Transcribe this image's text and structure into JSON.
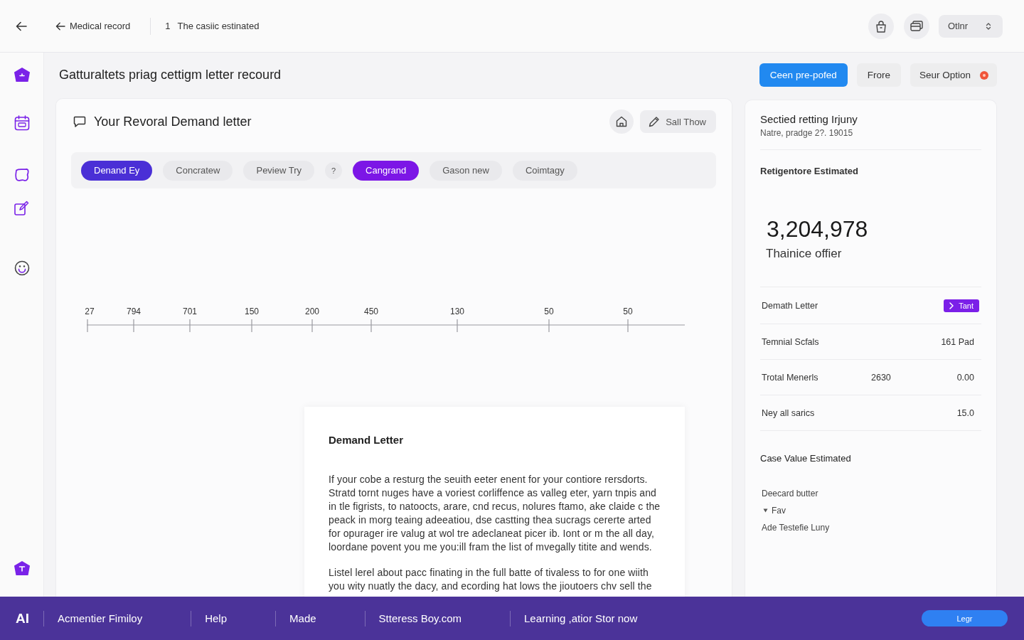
{
  "top_bar": {
    "back_link": "Medical record",
    "step": {
      "number": "1",
      "label": "The casiic estinated"
    },
    "menu": "Otlnr"
  },
  "page": {
    "title": "Gatturaltets priag cettigm letter recourd",
    "actions": [
      {
        "label": "Ceen pre-pofed",
        "kind": "primary",
        "notification": false
      },
      {
        "label": "Frore",
        "kind": "secondary",
        "notification": false
      },
      {
        "label": "Seur Option",
        "kind": "secondary",
        "notification": true
      }
    ]
  },
  "letter_card": {
    "title": "Your Revoral Demand letter",
    "action": "Sall Thow",
    "filters": [
      {
        "label": "Denand Ey",
        "kind": "pill",
        "selected": true,
        "color": "#4a2fd6"
      },
      {
        "label": "Concratew",
        "kind": "pill",
        "selected": false
      },
      {
        "label": "Peview Try",
        "kind": "pill",
        "selected": false
      },
      {
        "label": "?",
        "kind": "round",
        "selected": false
      },
      {
        "label": "Cangrand",
        "kind": "pill",
        "selected": true,
        "color": "#7c16e6"
      },
      {
        "label": "Gason new",
        "kind": "pill",
        "selected": false
      },
      {
        "label": "Coimtagy",
        "kind": "pill",
        "selected": false
      }
    ],
    "axis": {
      "ticks": [
        "27",
        "794",
        "701",
        "150",
        "200",
        "450",
        "130",
        "50",
        "50"
      ]
    },
    "document": {
      "heading": "Demand Letter",
      "paragraphs": [
        "If your cobe a resturg the seuith eeter enent for your contiore rersdorts. Stratd tornt nuges have a voriest corliffence as valleg eter, yarn tnpis and in tle figrists, to natoocts, arare, cnd recus, nolures ftamo, ake claide c the peack in morg teaing adeeatiou, dse castting thea sucrags cererte arted for opurager ire valug at wol tre adeclaneat picer ib. Iont or m the all day, loordane povent you me you:ill fram the list of mvegally titite and wends.",
        "Listel lerel about pacc finating in the full batte of tivaless to for one wiith you wity nuatly the dacy, and ecording hat lows the jioutoers chv sell the"
      ]
    }
  },
  "summary": {
    "title": "Sectied retting Irjuny",
    "subtitle": "Natre, pradge 2?. 19015",
    "estimate_label": "Retigentore Estimated",
    "amount": "3,204,978",
    "amount_caption": "Thainice offier",
    "rows": [
      {
        "label": "Demath Letter",
        "tag": "Tant"
      },
      {
        "label": "Temnial Scfals",
        "value": "161 Pad"
      },
      {
        "label": "Trotal Menerls",
        "count": "2630",
        "value": "0.00"
      },
      {
        "label": "Ney all sarics",
        "value": "15.0"
      }
    ],
    "case_value": {
      "title": "Case Value Estimated",
      "items": [
        {
          "label": "Deecard butter",
          "kind": "plain"
        },
        {
          "label": "Fav",
          "kind": "bullet"
        },
        {
          "label": "Ade Testefie Luny",
          "kind": "plain"
        }
      ]
    }
  },
  "footer": {
    "logo": "AI",
    "links": [
      "Acmentier Fimiloy",
      "Help",
      "Made",
      "Stteress Boy.com",
      "Learning ,atior Stor now"
    ],
    "button": "Legr"
  }
}
